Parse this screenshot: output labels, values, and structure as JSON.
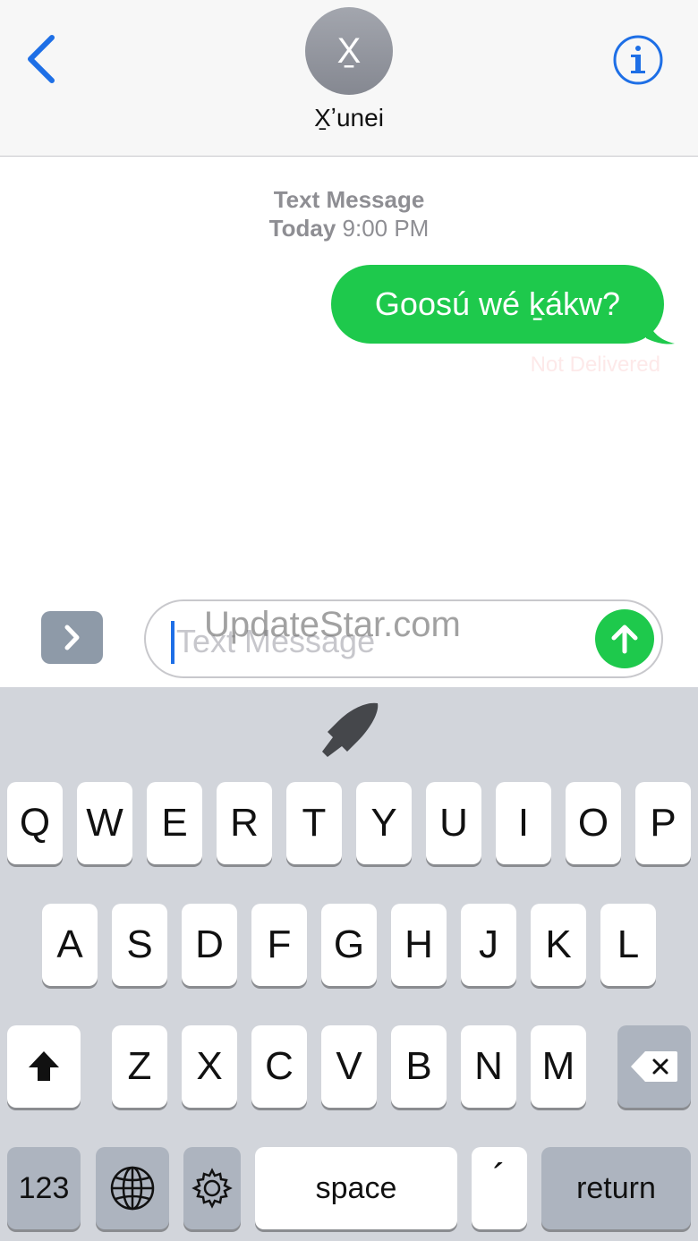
{
  "header": {
    "avatar_letter": "X̱",
    "contact_name": "X̱ʼunei"
  },
  "conversation": {
    "meta_title": "Text Message",
    "meta_day": "Today",
    "meta_time": "9:00 PM",
    "messages": [
      {
        "text": "Goosú wé ḵákw?",
        "status": "Not Delivered"
      }
    ]
  },
  "input": {
    "placeholder": "Text Message",
    "watermark": "UpdateStar.com"
  },
  "keyboard": {
    "row1": [
      "Q",
      "W",
      "E",
      "R",
      "T",
      "Y",
      "U",
      "I",
      "O",
      "P"
    ],
    "row2": [
      "A",
      "S",
      "D",
      "F",
      "G",
      "H",
      "J",
      "K",
      "L"
    ],
    "row3": [
      "Z",
      "X",
      "C",
      "V",
      "B",
      "N",
      "M"
    ],
    "numbers_label": "123",
    "space_label": "space",
    "accent_label": "´",
    "return_label": "return"
  },
  "colors": {
    "accent": "#1e6fe6",
    "bubble": "#1ec94c",
    "keyboard_bg": "#d2d5db"
  },
  "icons": [
    "back-chevron-icon",
    "info-icon",
    "apps-chevron-icon",
    "send-arrow-icon",
    "pen-icon",
    "shift-icon",
    "globe-icon",
    "gear-icon",
    "delete-icon"
  ]
}
